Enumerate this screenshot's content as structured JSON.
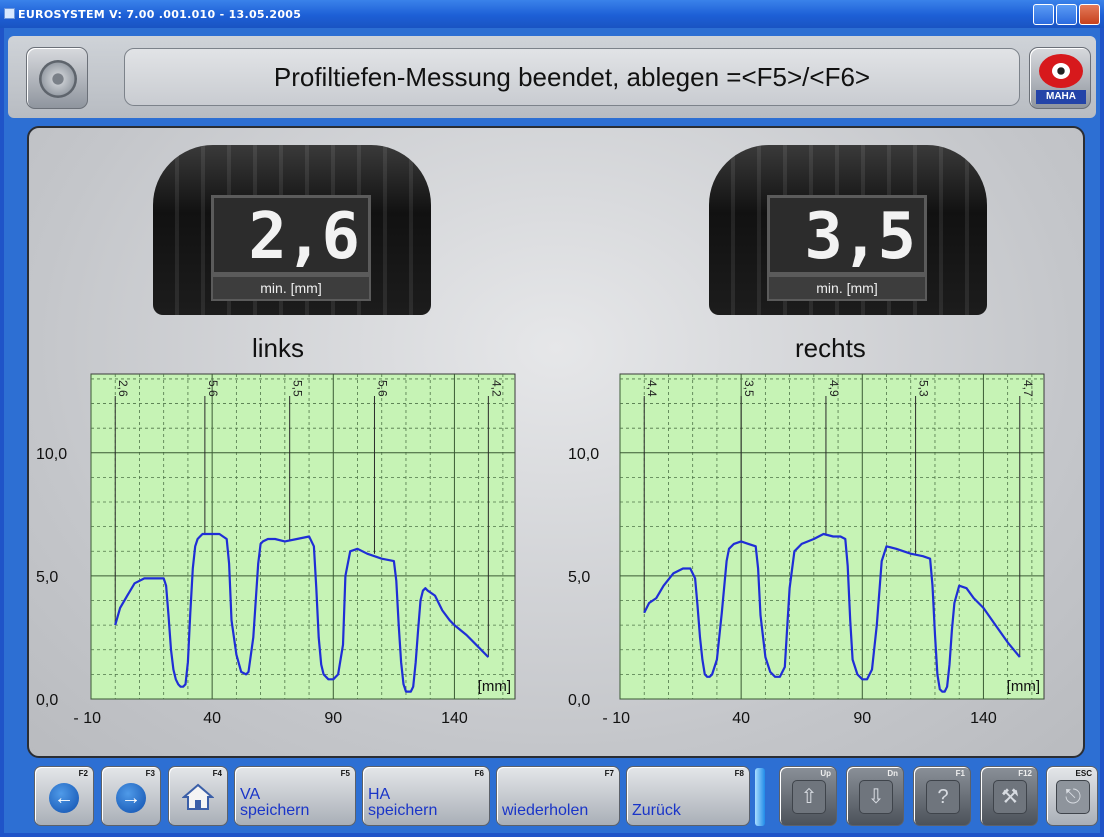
{
  "window": {
    "title": "EUROSYSTEM  V: 7.00    .001.010   -   13.05.2005"
  },
  "header": {
    "message": "Profiltiefen-Messung beendet, ablegen =<F5>/<F6>",
    "logo_text": "MAHA"
  },
  "left": {
    "value": "2,6",
    "unit": "min. [mm]",
    "label": "links"
  },
  "right": {
    "value": "3,5",
    "unit": "min. [mm]",
    "label": "rechts"
  },
  "chart_data": [
    {
      "type": "line",
      "title": "links",
      "x_ticks": [
        "- 10",
        "40",
        "90",
        "140"
      ],
      "y_ticks": [
        "0,0",
        "5,0",
        "10,0"
      ],
      "x_unit": "[mm]",
      "xlim": [
        -10,
        165
      ],
      "ylim": [
        0,
        13.2
      ],
      "grid": true,
      "markers": [
        {
          "x": 0,
          "label": "2,6"
        },
        {
          "x": 37,
          "label": "5,6"
        },
        {
          "x": 72,
          "label": "5,5"
        },
        {
          "x": 107,
          "label": "5,6"
        },
        {
          "x": 154,
          "label": "4,2"
        }
      ],
      "series": [
        {
          "color": "#1f2ed6",
          "x": [
            0,
            2,
            5,
            8,
            12,
            16,
            20,
            21,
            22,
            23,
            24,
            25,
            26,
            27,
            28,
            29,
            30,
            31,
            32,
            33,
            34,
            35,
            36,
            37,
            40,
            43,
            46,
            47,
            48,
            50,
            52,
            54,
            55,
            57,
            59,
            60,
            61,
            63,
            66,
            70,
            75,
            80,
            82,
            83,
            84,
            85,
            86,
            88,
            90,
            92,
            94,
            95,
            97,
            100,
            104,
            110,
            115,
            116,
            117,
            118,
            119,
            120,
            122,
            123,
            124,
            125,
            126,
            127,
            128,
            129,
            132,
            135,
            138,
            140,
            145,
            150,
            154
          ],
          "y": [
            3.0,
            3.7,
            4.2,
            4.7,
            4.9,
            4.9,
            4.9,
            4.6,
            3.4,
            2.0,
            1.2,
            0.8,
            0.6,
            0.5,
            0.5,
            0.6,
            1.5,
            3.5,
            5.3,
            6.2,
            6.5,
            6.6,
            6.7,
            6.7,
            6.7,
            6.7,
            6.5,
            5.5,
            3.2,
            1.8,
            1.1,
            1.0,
            1.1,
            2.5,
            5.5,
            6.3,
            6.4,
            6.5,
            6.5,
            6.4,
            6.5,
            6.6,
            6.2,
            4.5,
            2.5,
            1.4,
            1.0,
            0.8,
            0.8,
            1.0,
            2.2,
            5.0,
            6.0,
            6.1,
            5.9,
            5.7,
            5.6,
            4.8,
            3.0,
            1.5,
            0.6,
            0.3,
            0.3,
            0.5,
            1.5,
            2.8,
            4.0,
            4.4,
            4.5,
            4.4,
            4.2,
            3.6,
            3.2,
            3.0,
            2.6,
            2.1,
            1.7
          ]
        }
      ]
    },
    {
      "type": "line",
      "title": "rechts",
      "x_ticks": [
        "- 10",
        "40",
        "90",
        "140"
      ],
      "y_ticks": [
        "0,0",
        "5,0",
        "10,0"
      ],
      "x_unit": "[mm]",
      "xlim": [
        -10,
        165
      ],
      "ylim": [
        0,
        13.2
      ],
      "grid": true,
      "markers": [
        {
          "x": 0,
          "label": "4,4"
        },
        {
          "x": 40,
          "label": "3,5"
        },
        {
          "x": 75,
          "label": "4,9"
        },
        {
          "x": 112,
          "label": "5,3"
        },
        {
          "x": 155,
          "label": "4,7"
        }
      ],
      "series": [
        {
          "color": "#1f2ed6",
          "x": [
            0,
            2,
            5,
            8,
            12,
            16,
            19,
            21,
            22,
            23,
            24,
            25,
            26,
            27,
            28,
            30,
            32,
            34,
            35,
            37,
            40,
            43,
            46,
            47,
            48,
            50,
            52,
            54,
            56,
            58,
            60,
            62,
            65,
            70,
            74,
            78,
            81,
            83,
            84,
            85,
            86,
            88,
            90,
            92,
            94,
            96,
            98,
            100,
            104,
            110,
            115,
            118,
            119,
            120,
            121,
            122,
            123,
            124,
            125,
            126,
            127,
            128,
            130,
            133,
            136,
            140,
            145,
            150,
            155
          ],
          "y": [
            3.5,
            3.9,
            4.1,
            4.6,
            5.1,
            5.3,
            5.3,
            4.9,
            3.8,
            2.5,
            1.6,
            1.0,
            0.9,
            0.9,
            1.0,
            1.6,
            3.5,
            5.6,
            6.1,
            6.3,
            6.4,
            6.3,
            6.2,
            5.3,
            3.4,
            1.7,
            1.1,
            0.9,
            0.9,
            1.3,
            4.5,
            6.0,
            6.3,
            6.5,
            6.7,
            6.6,
            6.6,
            6.5,
            5.4,
            3.2,
            1.6,
            1.0,
            0.8,
            0.8,
            1.2,
            3.0,
            5.6,
            6.2,
            6.1,
            5.9,
            5.8,
            5.7,
            4.6,
            2.6,
            1.0,
            0.4,
            0.3,
            0.3,
            0.5,
            1.4,
            2.8,
            3.9,
            4.6,
            4.5,
            4.1,
            3.7,
            3.0,
            2.3,
            1.7
          ]
        }
      ]
    }
  ],
  "toolbar": {
    "buttons": [
      {
        "fkey": "F2",
        "icon": "arrow-left-icon"
      },
      {
        "fkey": "F3",
        "icon": "arrow-right-icon"
      },
      {
        "fkey": "F4",
        "icon": "home-icon"
      },
      {
        "fkey": "F5",
        "label_line1": "VA",
        "label_line2": "speichern"
      },
      {
        "fkey": "F6",
        "label_line1": "HA",
        "label_line2": "speichern"
      },
      {
        "fkey": "F7",
        "label_line1": "",
        "label_line2": "wiederholen"
      },
      {
        "fkey": "F8",
        "label_line1": "",
        "label_line2": "Zurück"
      },
      {
        "fkey": "Up",
        "icon": "arrow-up-icon"
      },
      {
        "fkey": "Dn",
        "icon": "arrow-down-icon"
      },
      {
        "fkey": "F1",
        "icon": "help-icon"
      },
      {
        "fkey": "F12",
        "icon": "tools-icon"
      },
      {
        "fkey": "ESC",
        "icon": "exit-icon"
      }
    ]
  }
}
